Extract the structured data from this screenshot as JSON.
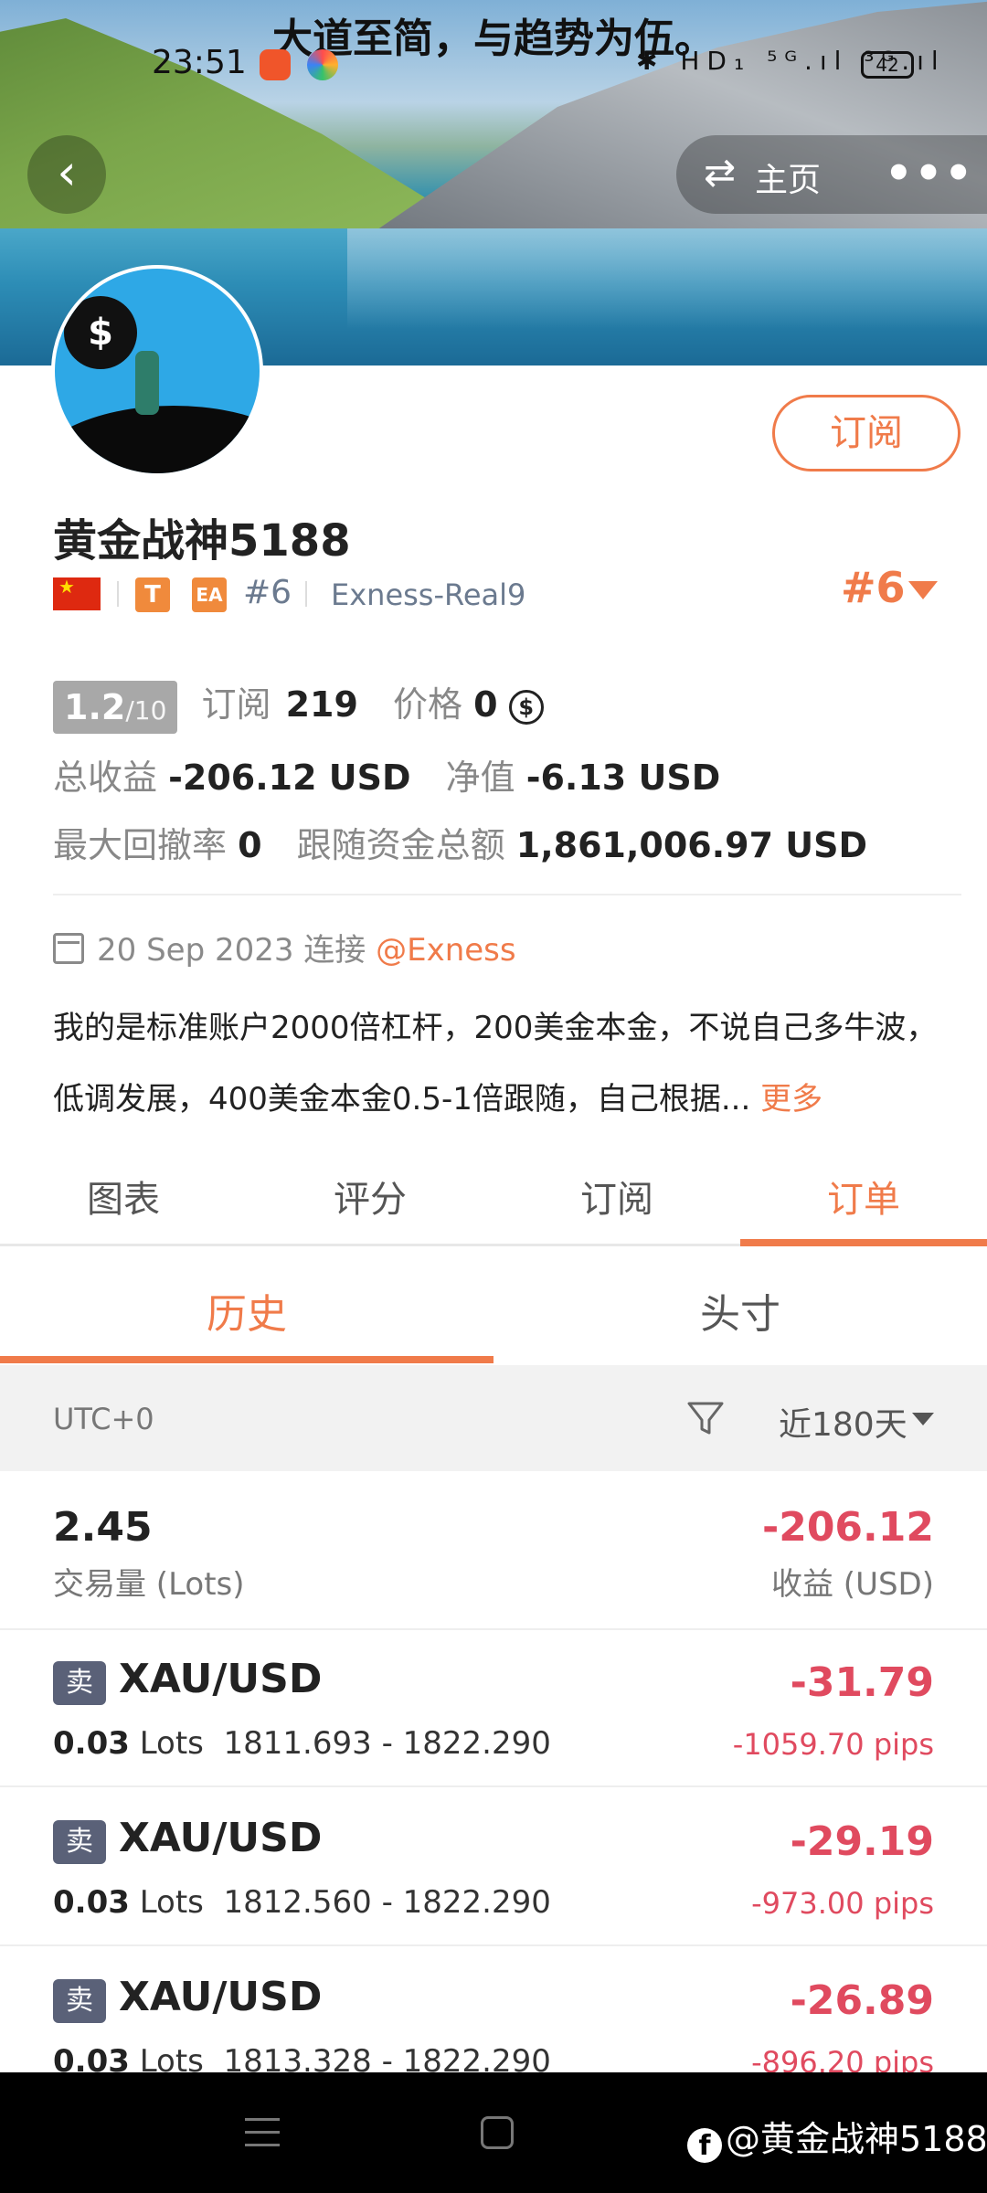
{
  "status_bar": {
    "slogan": "大道至简，与趋势为伍。",
    "time": "23:51",
    "icons": "✱ HD₁ ⁵ᴳ.ıl ³ᴳ.ıl",
    "battery": "42"
  },
  "nav": {
    "back_icon": "‹",
    "home_icon": "⇄",
    "home_label": "主页",
    "more_icon": "•••"
  },
  "profile": {
    "subscribe_label": "订阅",
    "name": "黄金战神5188",
    "tag_t": "T",
    "tag_ea": "EA",
    "rank": "#6",
    "server": "Exness-Real9",
    "rank_right": "#6"
  },
  "stats": {
    "score": "1.2",
    "score_max": "/10",
    "subscribe_label": "订阅",
    "subscribe_count": "219",
    "price_label": "价格",
    "price_value": "0",
    "coin_icon": "$",
    "total_profit_label": "总收益",
    "total_profit_value": "-206.12 USD",
    "net_label": "净值",
    "net_value": "-6.13 USD",
    "drawdown_label": "最大回撤率",
    "drawdown_value": "0",
    "follow_label": "跟随资金总额",
    "follow_value": "1,861,006.97 USD"
  },
  "connect": {
    "date": "20 Sep 2023 连接",
    "broker": "@Exness"
  },
  "description": {
    "text": "我的是标准账户2000倍杠杆，200美金本金，不说自己多牛波，低调发展，400美金本金0.5-1倍跟随，自己根据...",
    "more": "更多"
  },
  "main_tabs": [
    "图表",
    "评分",
    "订阅",
    "订单"
  ],
  "sub_tabs": [
    "历史",
    "头寸"
  ],
  "filter": {
    "timezone": "UTC+0",
    "range": "近180天"
  },
  "summary": {
    "lots": "2.45",
    "lots_label": "交易量 (Lots)",
    "profit": "-206.12",
    "profit_label": "收益 (USD)"
  },
  "orders": [
    {
      "side": "卖",
      "symbol": "XAU/USD",
      "lots": "0.03",
      "lots_unit": "Lots",
      "range": "1811.693 - 1822.290",
      "profit": "-31.79",
      "pips": "-1059.70 pips"
    },
    {
      "side": "卖",
      "symbol": "XAU/USD",
      "lots": "0.03",
      "lots_unit": "Lots",
      "range": "1812.560 - 1822.290",
      "profit": "-29.19",
      "pips": "-973.00 pips"
    },
    {
      "side": "卖",
      "symbol": "XAU/USD",
      "lots": "0.03",
      "lots_unit": "Lots",
      "range": "1813.328 - 1822.290",
      "profit": "-26.89",
      "pips": "-896.20 pips"
    }
  ],
  "watermark": "@黄金战神5188",
  "colors": {
    "accent": "#f07b4a",
    "loss": "#e04a5f",
    "badge": "#5a6178"
  }
}
